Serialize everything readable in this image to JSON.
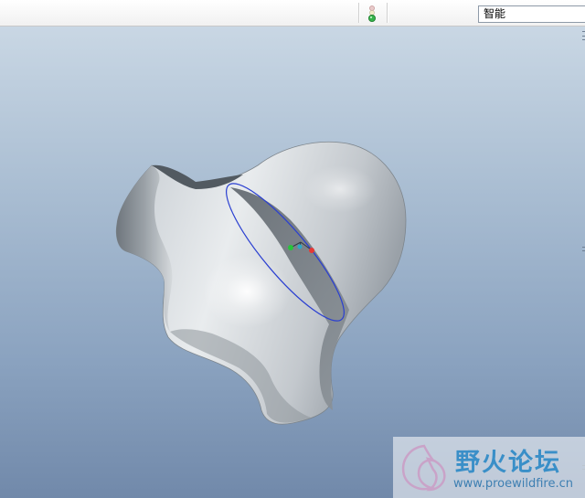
{
  "toolbar": {
    "status_icon": "traffic-light-icon",
    "filter": {
      "value": "智能"
    }
  },
  "viewport": {
    "background_top": "#c9d7e4",
    "background_bottom": "#7189aa",
    "model_icon": "freeform-surface-model",
    "datum_circle_color": "#2a3fd1",
    "axis_colors": {
      "x": "#e53935",
      "y": "#27c43b",
      "z": "#2ba8c8"
    }
  },
  "watermark": {
    "title": "野火论坛",
    "url": "www.proewildfire.cn",
    "logo_icon": "flame-logo-icon"
  }
}
